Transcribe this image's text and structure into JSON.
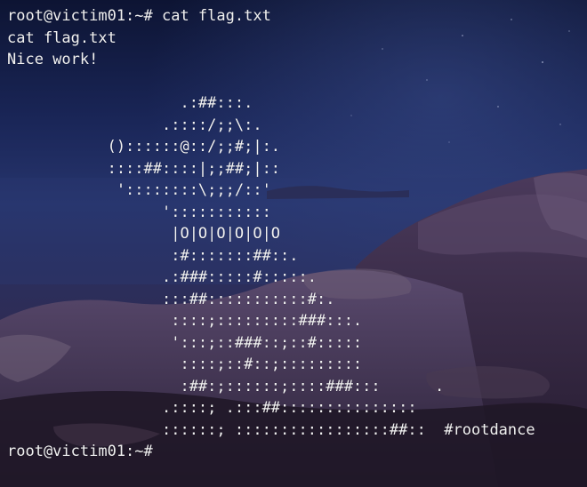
{
  "terminal": {
    "background_colors": [
      "#0b1026",
      "#1f2b63",
      "#3a2f5c",
      "#4a2e4f"
    ],
    "text_color": "#f2f2f2",
    "lines": [
      "root@victim01:~# cat flag.txt",
      "cat flag.txt",
      "Nice work!",
      "",
      "                   .:##:::.",
      "                 .::::/;;\\:.",
      "           ()::::::@::/;;#;|:.",
      "           ::::##::::|;;##;|::",
      "            '::::::::\\;;;/::'",
      "                 ':::::::::::",
      "                  |O|O|O|O|O|O",
      "                  :#:::::::##::.",
      "                 .:###:::::#:::::.",
      "                 :::##:::::::::::#:.",
      "                  ::::;:::::::::###:::.",
      "                  ':::;::###::;::#:::::",
      "                   ::::;::#::;:::::::::",
      "                   :##:;::::::;::::###:::      .",
      "                 .::::; .:::##:::::::::::::::",
      "                 ::::::; :::::::::::::::::##::  #rootdance",
      "root@victim01:~# "
    ]
  }
}
